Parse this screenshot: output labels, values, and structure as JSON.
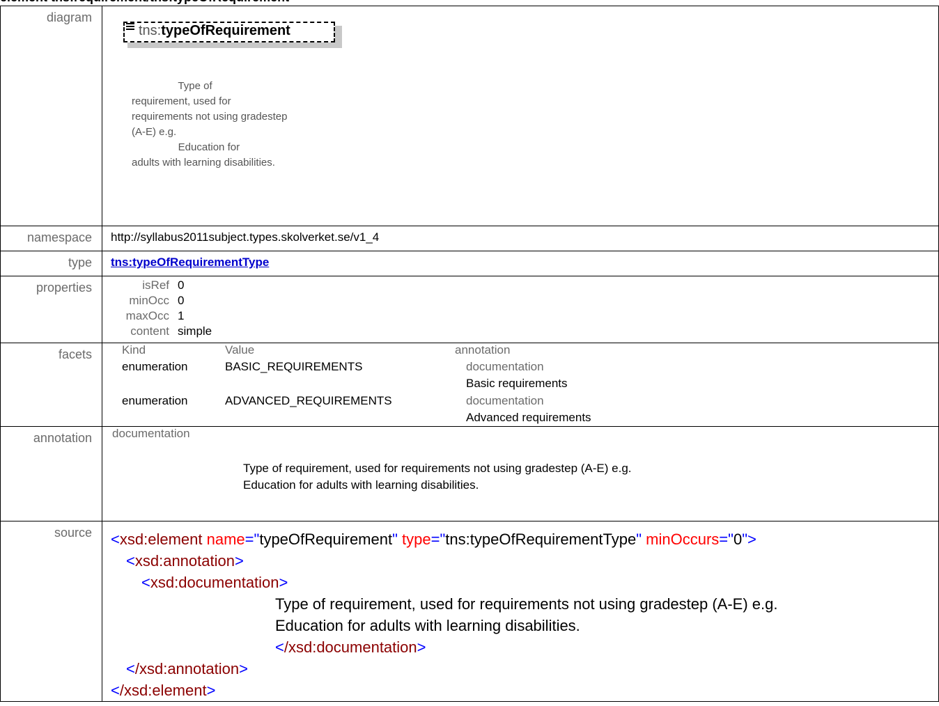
{
  "title": "element tns:requirement/tns:typeOfRequirement",
  "rows": {
    "diagram": {
      "label": "diagram",
      "node_ns": "tns:",
      "node_name": "typeOfRequirement",
      "doc_text": "                Type of\nrequirement, used for\nrequirements not using gradestep\n(A-E) e.g.\n                Education for\nadults with learning disabilities."
    },
    "namespace": {
      "label": "namespace",
      "value": "http://syllabus2011subject.types.skolverket.se/v1_4"
    },
    "type": {
      "label": "type",
      "value": "tns:typeOfRequirementType"
    },
    "properties": {
      "label": "properties",
      "items": [
        {
          "key": "isRef",
          "value": "0"
        },
        {
          "key": "minOcc",
          "value": "0"
        },
        {
          "key": "maxOcc",
          "value": "1"
        },
        {
          "key": "content",
          "value": "simple"
        }
      ]
    },
    "facets": {
      "label": "facets",
      "headers": {
        "kind": "Kind",
        "value": "Value",
        "annotation": "annotation"
      },
      "rows": [
        {
          "kind": "enumeration",
          "value": "BASIC_REQUIREMENTS",
          "doc_label": "documentation",
          "doc": "Basic requirements"
        },
        {
          "kind": "enumeration",
          "value": "ADVANCED_REQUIREMENTS",
          "doc_label": "documentation",
          "doc": "Advanced requirements"
        }
      ]
    },
    "annotation": {
      "label": "annotation",
      "doc_label": "documentation",
      "line1": "Type of requirement, used for requirements not using gradestep (A-E) e.g.",
      "line2": "Education for adults with learning disabilities."
    },
    "source": {
      "label": "source",
      "open_tag": "xsd:element",
      "attr_name": "name",
      "attr_name_val": "typeOfRequirement",
      "attr_type": "type",
      "attr_type_val": "tns:typeOfRequirementType",
      "attr_min": "minOccurs",
      "attr_min_val": "0",
      "annotation_tag": "xsd:annotation",
      "documentation_tag": "xsd:documentation",
      "doc_line1": "Type of requirement, used for requirements not using gradestep (A-E) e.g.",
      "doc_line2": "Education for adults with learning disabilities.",
      "close_documentation": "/xsd:documentation",
      "close_annotation": "/xsd:annotation",
      "close_element": "/xsd:element"
    }
  }
}
